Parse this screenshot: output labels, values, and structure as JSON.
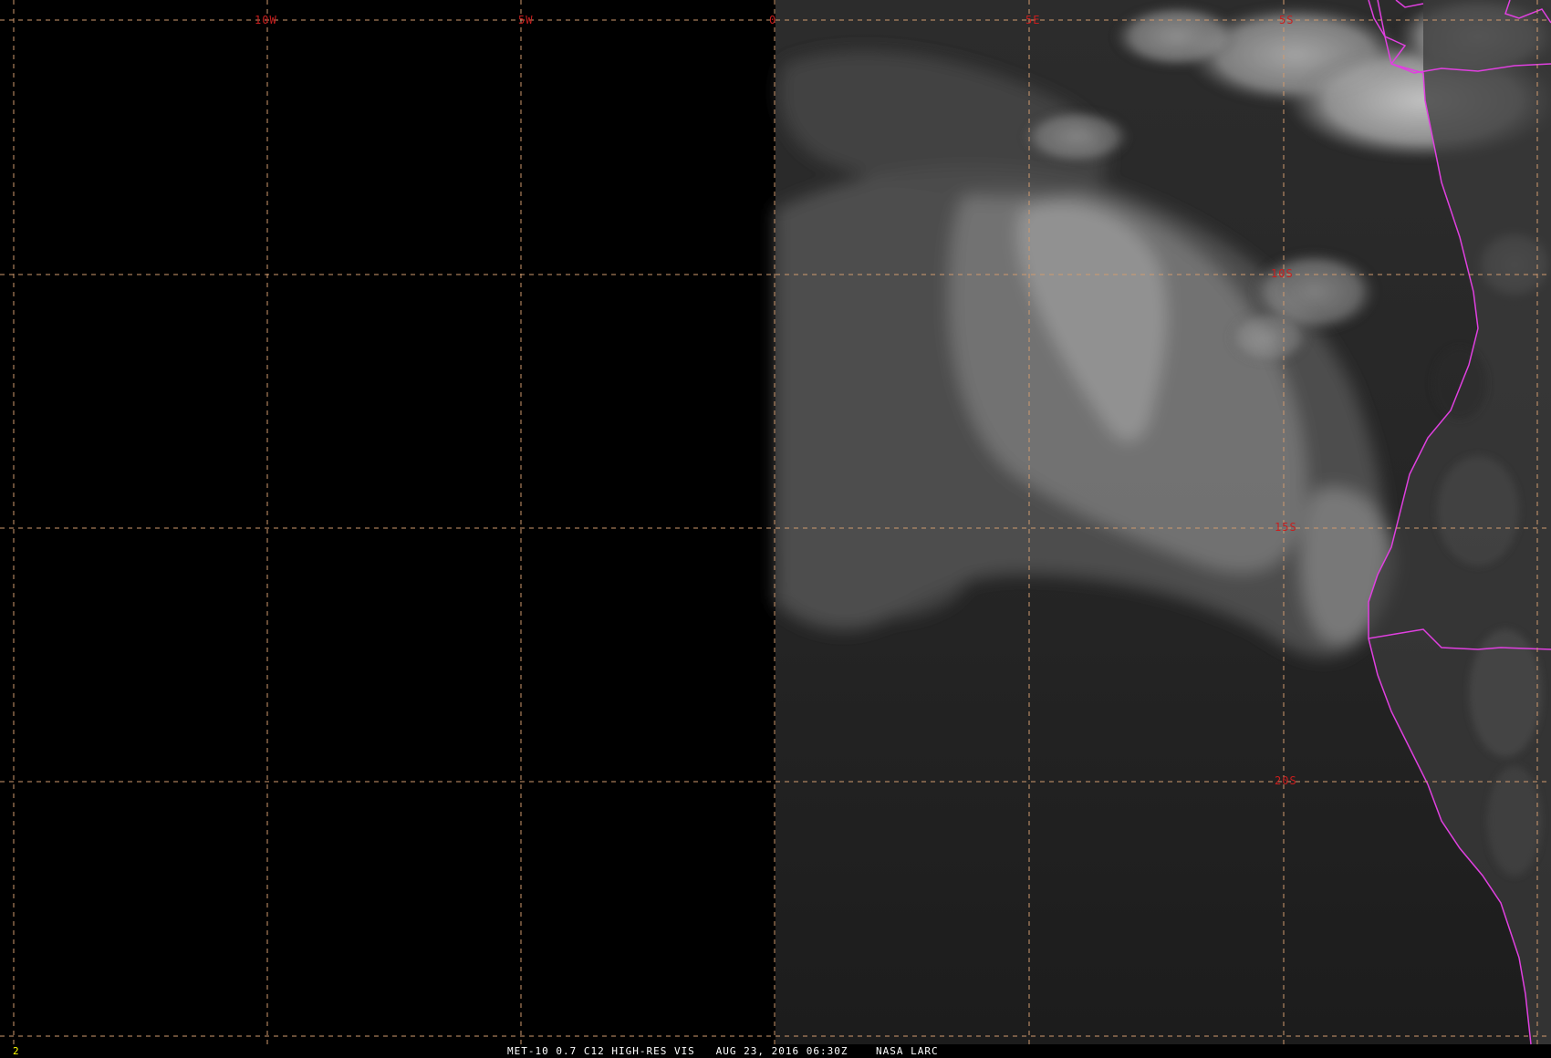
{
  "image": {
    "satellite": "MET-10",
    "channel": "0.7",
    "channel_id": "C12",
    "product": "HIGH-RES VIS",
    "datetime": "AUG 23, 2016 06:30Z",
    "source": "NASA LARC",
    "caption_line": "MET-10 0.7 C12 HIGH-RES VIS   AUG 23, 2016 06:30Z    NASA LARC",
    "frame_number": "2"
  },
  "map": {
    "longitude_labels": [
      "10W",
      "5W",
      "0",
      "5E",
      "5S"
    ],
    "latitude_labels": [
      "10S",
      "15S",
      "20S"
    ],
    "grid_style": "dashed",
    "colors": {
      "background": "#000000",
      "grid": "#d09a6e",
      "grid_label": "#c81e1e",
      "borders": "#e040e0",
      "caption_text": "#ffffff",
      "frame_number_text": "#ffff00"
    }
  }
}
